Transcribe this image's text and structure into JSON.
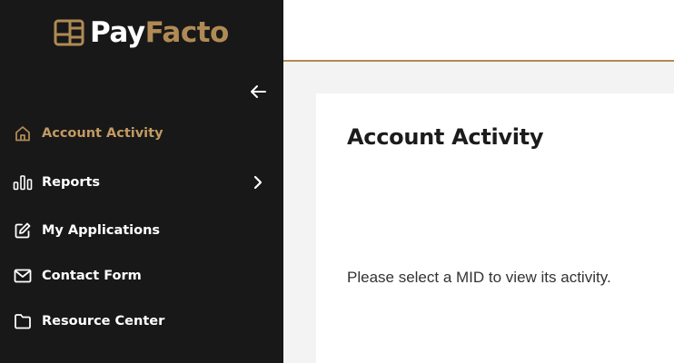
{
  "brand": {
    "name_part1": "Pay",
    "name_part2": "Facto",
    "primary_color": "#b08a55",
    "sidebar_bg": "#181818"
  },
  "sidebar": {
    "collapse_icon": "arrow-left-icon",
    "items": [
      {
        "label": "Account Activity",
        "icon": "home-icon",
        "active": true
      },
      {
        "label": "Reports",
        "icon": "bar-chart-icon",
        "has_submenu": true
      },
      {
        "label": "My Applications",
        "icon": "edit-icon"
      },
      {
        "label": "Contact Form",
        "icon": "mail-icon"
      },
      {
        "label": "Resource Center",
        "icon": "folder-icon"
      }
    ]
  },
  "main": {
    "title": "Account Activity",
    "message": "Please select a MID to view its activity."
  }
}
